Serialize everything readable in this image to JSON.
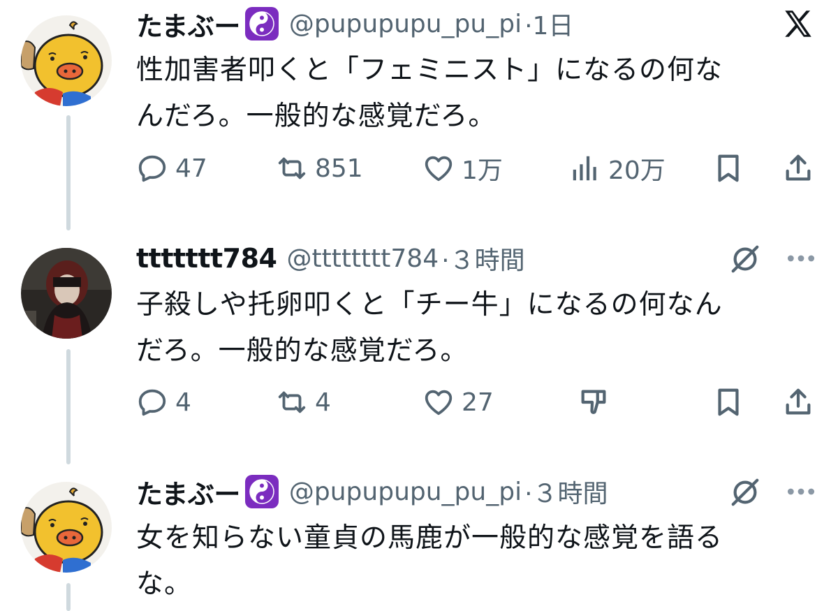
{
  "tweets": [
    {
      "display_name": "たまぶー",
      "handle": "@pupupupu_pu_pi",
      "time": "·1日",
      "text_line1": "性加害者叩くと「フェミニスト」になるの何な",
      "text_line2": "んだろ。一般的な感覚だろ。",
      "actions": {
        "replies": "47",
        "retweets": "851",
        "likes": "1万",
        "views": "20万"
      }
    },
    {
      "display_name": "ttttttt784",
      "handle": "@tttttttt784",
      "time": "·３時間",
      "text_line1": "子殺しや托卵叩くと「チー牛」になるの何なん",
      "text_line2": "だろ。一般的な感覚だろ。",
      "actions": {
        "replies": "4",
        "retweets": "4",
        "likes": "27"
      }
    },
    {
      "display_name": "たまぶー",
      "handle": "@pupupupu_pu_pi",
      "time": "·３時間",
      "text_line1": "女を知らない童貞の馬鹿が一般的な感覚を語る",
      "text_line2": "な。"
    }
  ],
  "icons": {
    "app_logo": "x-logo-icon",
    "badge": "yin-yang-badge-icon",
    "grok": "grok-icon",
    "more": "more-dots-icon"
  },
  "colors": {
    "text": "#0f1419",
    "secondary": "#536471",
    "badge": "#7b2cbf",
    "thread_line": "#cfd9de"
  }
}
